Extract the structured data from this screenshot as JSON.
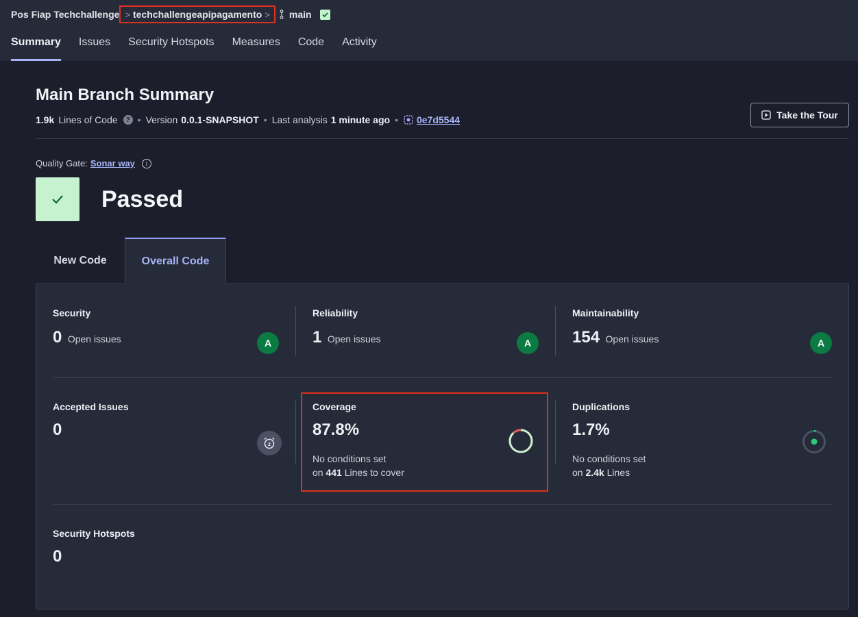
{
  "breadcrumb": {
    "organization": "Pos Fiap Techchallenge",
    "project": "techchallengeapipagamento",
    "separator": ">",
    "branch": "main"
  },
  "nav": {
    "tabs": [
      {
        "label": "Summary",
        "active": true
      },
      {
        "label": "Issues"
      },
      {
        "label": "Security Hotspots"
      },
      {
        "label": "Measures"
      },
      {
        "label": "Code"
      },
      {
        "label": "Activity"
      }
    ]
  },
  "header": {
    "title": "Main Branch Summary",
    "loc_value": "1.9k",
    "loc_label": "Lines of Code",
    "help": "?",
    "version_label": "Version",
    "version_value": "0.0.1-SNAPSHOT",
    "analysis_label": "Last analysis",
    "analysis_value": "1 minute ago",
    "commit": "0e7d5544",
    "tour_button": "Take the Tour"
  },
  "quality_gate": {
    "label": "Quality Gate:",
    "link": "Sonar way",
    "info": "i",
    "status": "Passed"
  },
  "code_tabs": {
    "new_code": "New Code",
    "overall_code": "Overall Code"
  },
  "metrics": {
    "security": {
      "title": "Security",
      "value": "0",
      "sub": "Open issues",
      "rating": "A"
    },
    "reliability": {
      "title": "Reliability",
      "value": "1",
      "sub": "Open issues",
      "rating": "A"
    },
    "maintainability": {
      "title": "Maintainability",
      "value": "154",
      "sub": "Open issues",
      "rating": "A"
    },
    "accepted": {
      "title": "Accepted Issues",
      "value": "0",
      "icon_text": "z"
    },
    "coverage": {
      "title": "Coverage",
      "value": "87.8%",
      "percent": 87.8,
      "note1": "No conditions set",
      "note2_prefix": "on",
      "note2_value": "441",
      "note2_suffix": "Lines to cover"
    },
    "duplications": {
      "title": "Duplications",
      "value": "1.7%",
      "percent": 1.7,
      "note1": "No conditions set",
      "note2_prefix": "on",
      "note2_value": "2.4k",
      "note2_suffix": "Lines"
    },
    "hotspots": {
      "title": "Security Hotspots",
      "value": "0"
    }
  },
  "colors": {
    "background": "#1c1f2b",
    "panel": "#262b39",
    "accent": "#a8b4f8",
    "rating_a": "#0c7a43",
    "passed": "#c6f2d0",
    "highlight": "#e0301e"
  }
}
